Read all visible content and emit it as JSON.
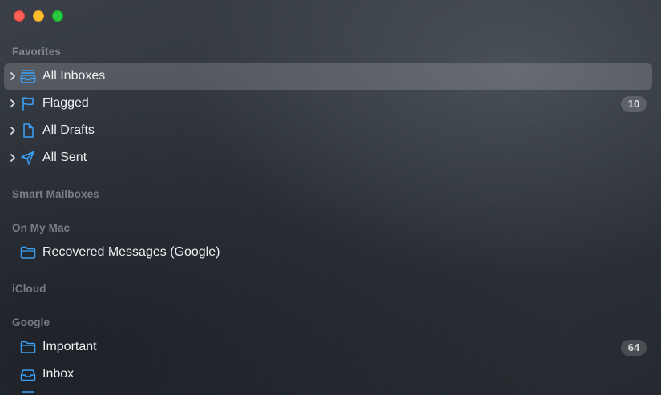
{
  "window": {
    "controls": [
      "close",
      "minimize",
      "zoom"
    ]
  },
  "colors": {
    "accent": "#3aa0f5",
    "selected_row_bg": "rgba(255,255,255,0.16)"
  },
  "sections": {
    "favorites": {
      "title": "Favorites",
      "items": [
        {
          "label": "All Inboxes",
          "icon": "tray-stack-icon",
          "selected": true,
          "badge": ""
        },
        {
          "label": "Flagged",
          "icon": "flag-icon",
          "selected": false,
          "badge": "10"
        },
        {
          "label": "All Drafts",
          "icon": "document-icon",
          "selected": false,
          "badge": ""
        },
        {
          "label": "All Sent",
          "icon": "paper-plane-icon",
          "selected": false,
          "badge": ""
        }
      ]
    },
    "smart_mailboxes": {
      "title": "Smart Mailboxes"
    },
    "on_my_mac": {
      "title": "On My Mac",
      "items": [
        {
          "label": "Recovered Messages (Google)",
          "icon": "folder-icon",
          "badge": ""
        }
      ]
    },
    "icloud": {
      "title": "iCloud"
    },
    "google": {
      "title": "Google",
      "items": [
        {
          "label": "Important",
          "icon": "folder-icon",
          "badge": "64"
        },
        {
          "label": "Inbox",
          "icon": "tray-icon",
          "badge": ""
        }
      ]
    }
  }
}
